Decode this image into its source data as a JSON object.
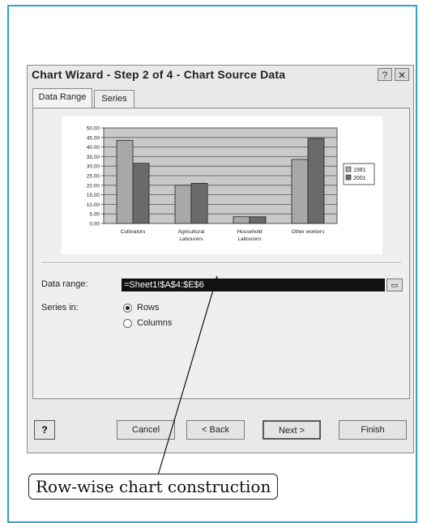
{
  "dialog": {
    "title": "Chart Wizard - Step 2 of 4 - Chart Source Data",
    "help_glyph": "?",
    "close_glyph": "✕"
  },
  "tabs": [
    {
      "label": "Data Range",
      "active": true
    },
    {
      "label": "Series",
      "active": false
    }
  ],
  "chart_data": {
    "type": "bar",
    "categories": [
      "Cultivators",
      "Agricultural Labourers",
      "Household Labourers",
      "Other workers"
    ],
    "category_lines": [
      [
        "Cultivators"
      ],
      [
        "Agricultural",
        "Labourers"
      ],
      [
        "Household",
        "Labourers"
      ],
      [
        "Other workers"
      ]
    ],
    "series": [
      {
        "name": "1981",
        "values": [
          43.5,
          20.0,
          3.5,
          33.5
        ],
        "color": "#a8a8a8"
      },
      {
        "name": "2001",
        "values": [
          31.5,
          21.0,
          3.5,
          44.5
        ],
        "color": "#6a6a6a"
      }
    ],
    "ylim": [
      0,
      50
    ],
    "yticks": [
      "0.00",
      "5.00",
      "10.00",
      "15.00",
      "20.00",
      "25.00",
      "30.00",
      "35.00",
      "40.00",
      "45.00",
      "50.00"
    ],
    "grid": true,
    "legend": "right"
  },
  "form": {
    "data_range_label": "Data range:",
    "data_range_value": "=Sheet1!$A$4:$E$6",
    "series_in_label": "Series in:",
    "rows_label": "Rows",
    "columns_label": "Columns",
    "series_in_selected": "Rows"
  },
  "buttons": {
    "help": "?",
    "cancel": "Cancel",
    "back": "< Back",
    "next": "Next >",
    "finish": "Finish"
  },
  "caption": "Row-wise chart construction",
  "colors": {
    "frame": "#29a3d6",
    "dialog_bg": "#e9e9e9"
  }
}
